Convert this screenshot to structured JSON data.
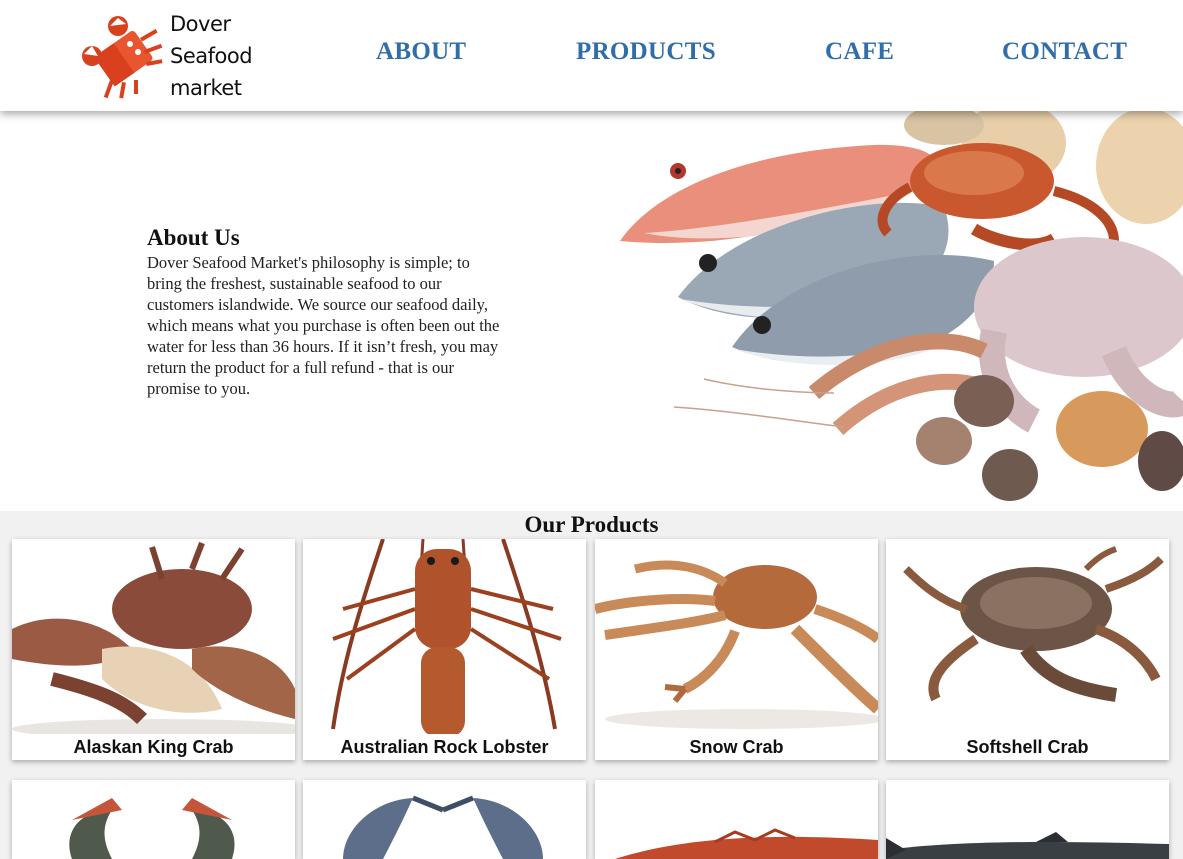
{
  "brand": {
    "line1": "Dover",
    "line2": "Seafood",
    "line3": "market",
    "accent_color": "#e8552f"
  },
  "nav": {
    "about": "ABOUT",
    "products": "PRODUCTS",
    "cafe": "CAFE",
    "contact": "CONTACT",
    "link_color": "#2f6ea9"
  },
  "about": {
    "title": "About Us",
    "body": "Dover Seafood Market's philosophy is simple; to bring the freshest, sustainable seafood to our customers islandwide. We source our seafood daily, which means what you purchase is often been out the water for less than 36 hours. If it isn’t fresh, you may return the product for a full refund - that is our promise to you."
  },
  "products": {
    "title": "Our Products",
    "items": [
      {
        "name": "Alaskan King Crab"
      },
      {
        "name": "Australian Rock Lobster"
      },
      {
        "name": "Snow Crab"
      },
      {
        "name": "Softshell Crab"
      }
    ]
  }
}
